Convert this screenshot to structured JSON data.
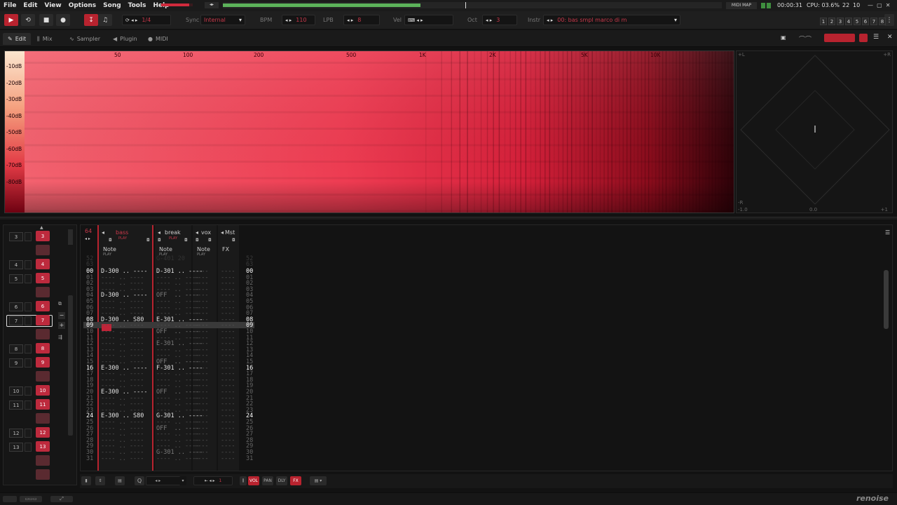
{
  "menu": [
    "File",
    "Edit",
    "View",
    "Options",
    "Song",
    "Tools",
    "Help"
  ],
  "transport": {
    "pattern_pos": "1/4",
    "sync_label": "Sync",
    "sync_value": "Internal",
    "bpm_label": "BPM",
    "bpm_value": "110",
    "lpb_label": "LPB",
    "lpb_value": "8",
    "vel_label": "Vel",
    "oct_label": "Oct",
    "oct_value": "3",
    "instr_label": "Instr",
    "instr_value": "00: bas smpl marco di m",
    "midi_map": "MIDI MAP",
    "time": "00:00:31",
    "cpu": "CPU: 03.6%",
    "counter_a": "22",
    "counter_b": "10",
    "track_buttons": [
      "1",
      "2",
      "3",
      "4",
      "5",
      "6",
      "7",
      "8"
    ]
  },
  "tabs": [
    {
      "label": "Edit",
      "icon": "edit-icon"
    },
    {
      "label": "Mix",
      "icon": "mix-icon"
    },
    {
      "label": "Sampler",
      "icon": "sampler-icon"
    },
    {
      "label": "Plugin",
      "icon": "plugin-icon"
    },
    {
      "label": "MIDI",
      "icon": "midi-icon"
    }
  ],
  "spectrum": {
    "db_labels": [
      "-10dB",
      "-20dB",
      "-30dB",
      "-40dB",
      "-50dB",
      "-60dB",
      "-70dB",
      "-80dB"
    ],
    "freq_labels": [
      "50",
      "100",
      "200",
      "500",
      "1K",
      "2K",
      "5K",
      "10K"
    ]
  },
  "scope": {
    "left_top": "+L",
    "right_top": "+R",
    "left_bottom": "-R",
    "x_min": "-1.0",
    "x_mid": "0.0",
    "x_max": "+1"
  },
  "instruments": {
    "numbers": [
      "3",
      "4",
      "5",
      "6",
      "7",
      "8",
      "9",
      "10",
      "11",
      "12",
      "13"
    ],
    "chips": [
      "3",
      "",
      "4",
      "5",
      "",
      "6",
      "7",
      "",
      "8",
      "9",
      "",
      "10",
      "11",
      "",
      "12",
      "13",
      "",
      ""
    ]
  },
  "pattern": {
    "number": "64",
    "tracks": [
      {
        "name": "bass",
        "sub": "Note",
        "status": "PLAY"
      },
      {
        "name": "break",
        "sub": "Note",
        "status": "PLAY"
      },
      {
        "name": "vox",
        "sub": "Note",
        "status": "PLAY"
      },
      {
        "name": "Mst",
        "sub": "FX",
        "status": ""
      }
    ],
    "prev_rows": [
      "52",
      "63"
    ],
    "bass_rows": [
      "D-300 .. ----",
      "---- .. ----",
      "---- .. ----",
      "---- .. ----",
      "D-300 .. ----",
      "---- .. ----",
      "---- .. ----",
      "---- .. ----",
      "D-300 .. S80 ",
      "---- .. ----",
      "---- .. ----",
      "---- .. ----",
      "---- .. ----",
      "---- .. ----",
      "---- .. ----",
      "---- .. ----",
      "E-300 .. ----",
      "---- .. ----",
      "---- .. ----",
      "---- .. ----",
      "E-300 .. ----",
      "---- .. ----",
      "---- .. ----",
      "---- .. ----",
      "E-300 .. S80 ",
      "---- .. ----",
      "---- .. ----",
      "---- .. ----",
      "---- .. ----",
      "---- .. ----",
      "---- .. ----",
      "---- .. ----"
    ],
    "break_rows": [
      "D-301 .. ----",
      "---- .. ----",
      "---- .. ----",
      "---- .. ----",
      "OFF  .. ----",
      "---- .. ----",
      "---- .. ----",
      "---- .. ----",
      "E-301 .. ----",
      "---- .. ----",
      "OFF  .. ----",
      "---- .. ----",
      "E-301 .. ----",
      "---- .. ----",
      "---- .. ----",
      "OFF  .. ----",
      "F-301 .. ----",
      "---- .. ----",
      "---- .. ----",
      "---- .. ----",
      "OFF  .. ----",
      "---- .. ----",
      "---- .. ----",
      "---- .. ----",
      "G-301 .. ----",
      "---- .. ----",
      "OFF  .. ----",
      "---- .. ----",
      "---- .. ----",
      "---- .. ----",
      "G-301 .. ----",
      "---- .. ----"
    ],
    "break_ghost": "G-401 20",
    "row_numbers": [
      "00",
      "01",
      "02",
      "03",
      "04",
      "05",
      "06",
      "07",
      "08",
      "09",
      "10",
      "11",
      "12",
      "13",
      "14",
      "15",
      "16",
      "17",
      "18",
      "19",
      "20",
      "21",
      "22",
      "23",
      "24",
      "25",
      "26",
      "27",
      "28",
      "29",
      "30",
      "31"
    ],
    "highlight_rows": [
      0,
      8,
      16,
      24
    ],
    "cursor_row": 9
  },
  "bottom": {
    "vol": "VOL",
    "pan": "PAN",
    "dly": "DLY",
    "fx": "FX",
    "step": "1"
  },
  "logo": "renoise",
  "colors": {
    "accent": "#b8232f",
    "spectrum_hot": "#f0304a",
    "background": "#121212"
  }
}
